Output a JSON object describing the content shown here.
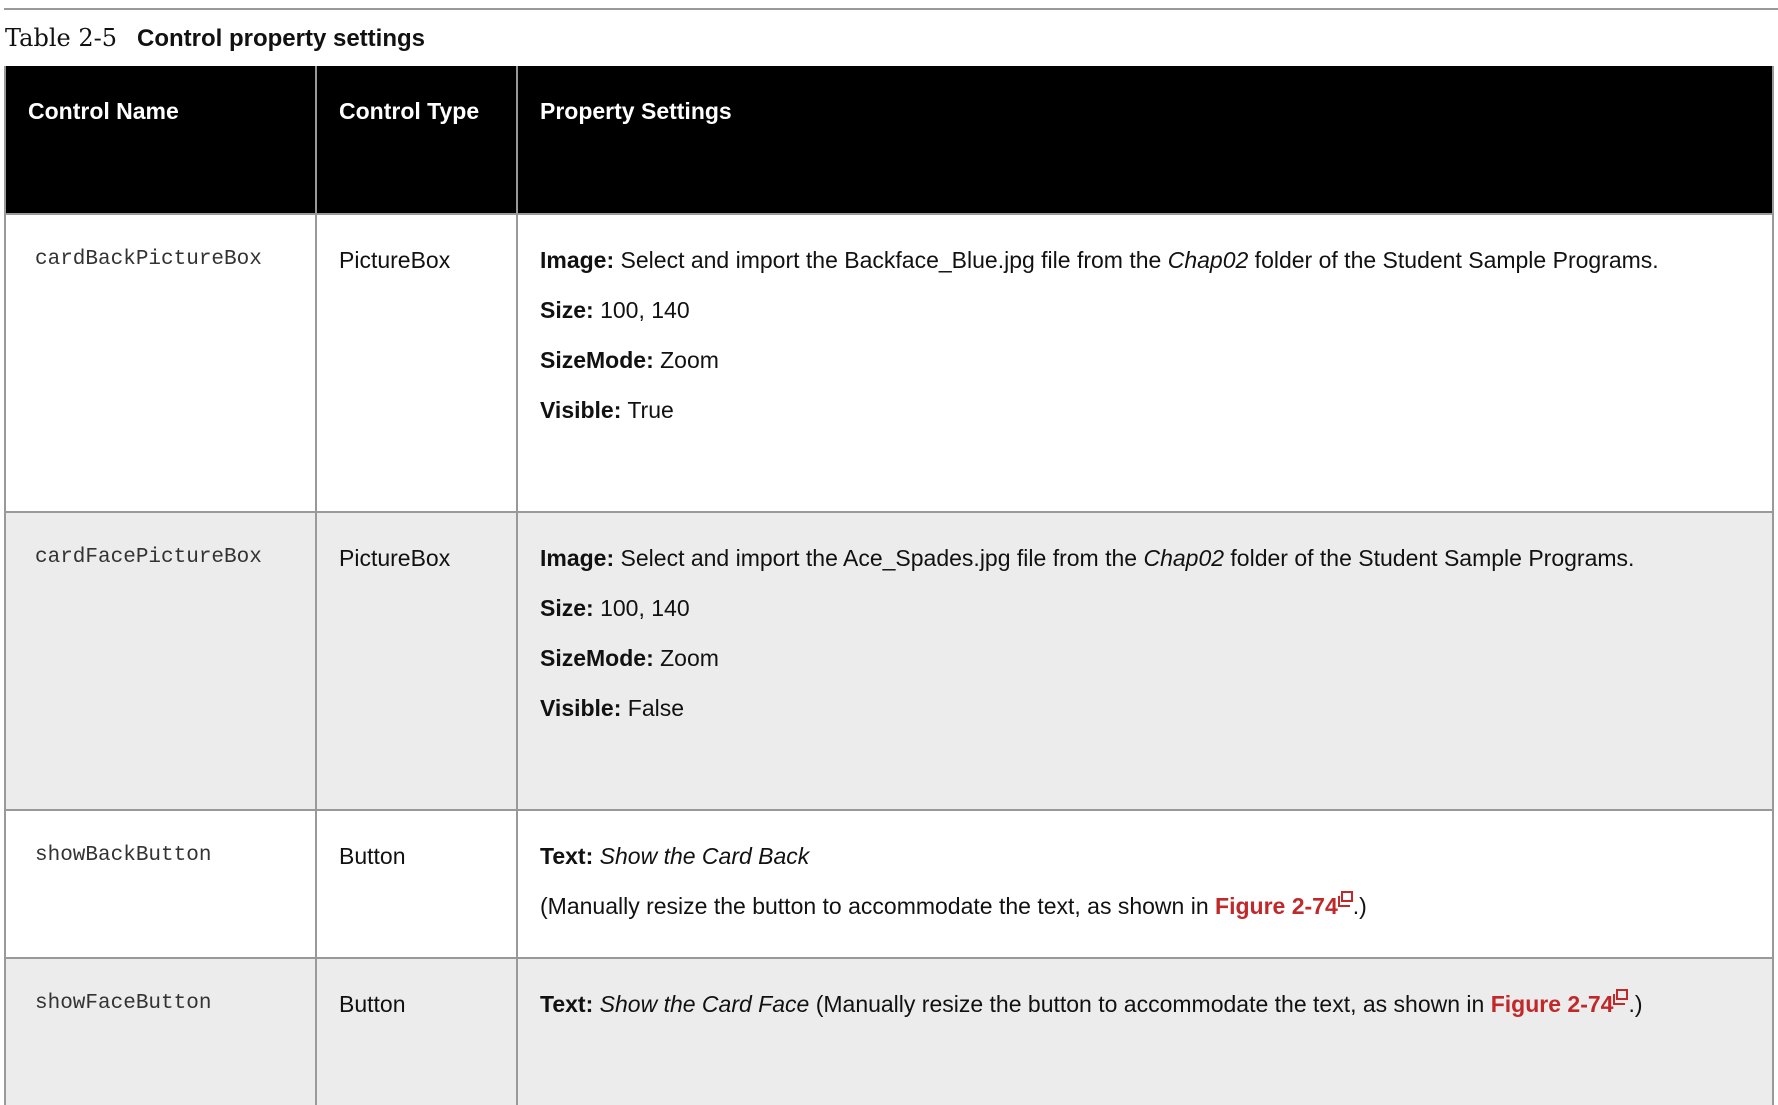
{
  "caption": {
    "number": "Table 2-5",
    "title": "Control property settings"
  },
  "headers": [
    "Control Name",
    "Control Type",
    "Property Settings"
  ],
  "rows": [
    {
      "name": "cardBackPictureBox",
      "type": "PictureBox",
      "image_label": "Image:",
      "image_pre": " Select and import the Backface_Blue.jpg file from the ",
      "image_folder": "Chap02",
      "image_post": " folder of the Student Sample Programs.",
      "size_label": "Size:",
      "size": " 100, 140",
      "sizemode_label": "SizeMode:",
      "sizemode": " Zoom",
      "visible_label": "Visible:",
      "visible": " True"
    },
    {
      "name": "cardFacePictureBox",
      "type": "PictureBox",
      "image_label": "Image:",
      "image_pre": " Select and import the Ace_Spades.jpg file from the ",
      "image_folder": "Chap02",
      "image_post": " folder of the Student Sample Programs.",
      "size_label": "Size:",
      "size": " 100, 140",
      "sizemode_label": "SizeMode:",
      "sizemode": " Zoom",
      "visible_label": "Visible:",
      "visible": " False"
    },
    {
      "name": "showBackButton",
      "type": "Button",
      "text_label": "Text:",
      "text_value": " Show the Card Back",
      "note_pre": "(Manually resize the button to accommodate the text, as shown in ",
      "link": "Figure 2-74",
      "note_post": ".)"
    },
    {
      "name": "showFaceButton",
      "type": "Button",
      "text_label": "Text:",
      "text_value": " Show the Card Face",
      "note_pre": " (Manually resize the button to accommodate the text, as shown in ",
      "link": "Figure 2-74",
      "note_post": ".)"
    }
  ],
  "colors": {
    "link": "#c0282a",
    "header_bg": "#000000",
    "alt_row": "#ececec"
  }
}
